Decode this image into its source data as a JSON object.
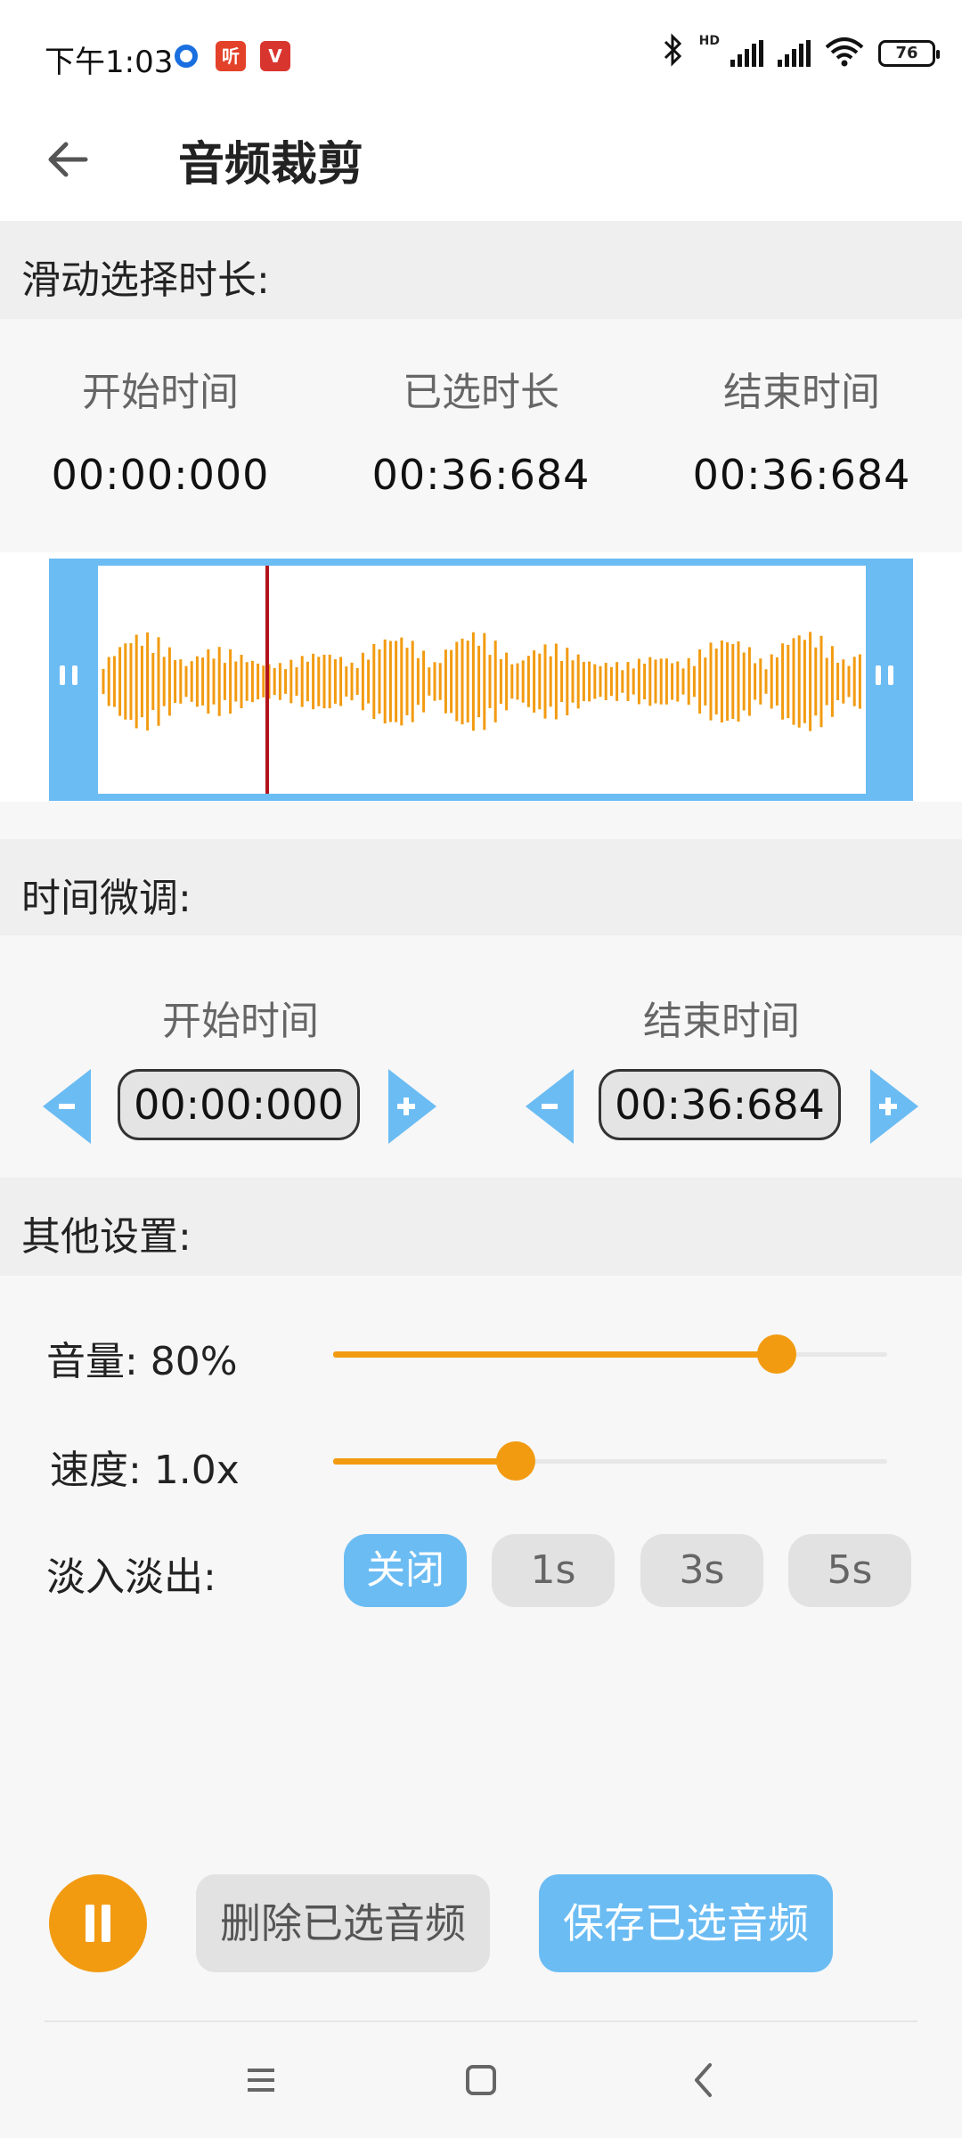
{
  "status": {
    "time": "下午1:03",
    "badge_ting": "听",
    "badge_v": "V",
    "hd": "HD",
    "battery": "76"
  },
  "header": {
    "title": "音频裁剪"
  },
  "sections": {
    "range": "滑动选择时长:",
    "finetune": "时间微调:",
    "other": "其他设置:"
  },
  "range": {
    "start_label": "开始时间",
    "start_value": "00:00:000",
    "selected_label": "已选时长",
    "selected_value": "00:36:684",
    "end_label": "结束时间",
    "end_value": "00:36:684"
  },
  "finetune": {
    "start_label": "开始时间",
    "start_value": "00:00:000",
    "end_label": "结束时间",
    "end_value": "00:36:684"
  },
  "settings": {
    "volume_label": "音量: 80%",
    "volume_level": 0.8,
    "speed_label": "速度: 1.0x",
    "speed_level": 0.33,
    "fade_label": "淡入淡出:",
    "fade_options": [
      "关闭",
      "1s",
      "3s",
      "5s"
    ],
    "fade_selected": "关闭"
  },
  "actions": {
    "delete": "删除已选音频",
    "save": "保存已选音频"
  },
  "colors": {
    "accent_blue": "#6bbcf3",
    "accent_orange": "#f29b11",
    "playhead": "#b2141c"
  },
  "icons": {
    "back": "arrow-left-icon",
    "pause": "pause-icon",
    "nav_menu": "menu-icon",
    "nav_home": "square-icon",
    "nav_back": "chevron-left-icon"
  }
}
